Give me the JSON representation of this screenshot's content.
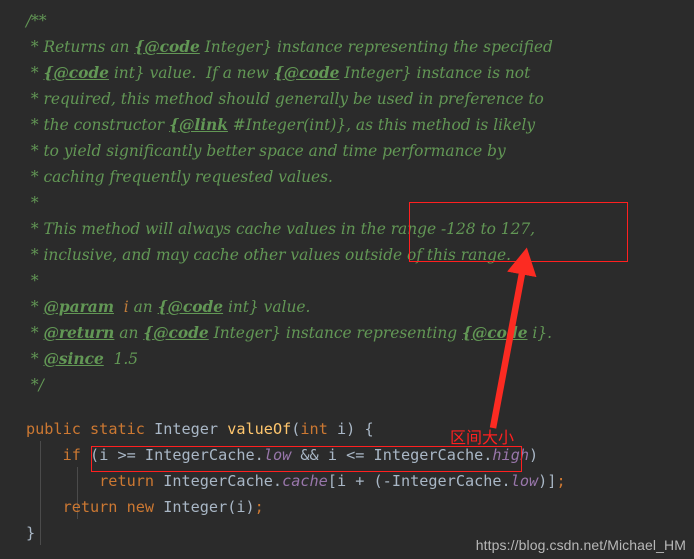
{
  "editor": {
    "background_color": "#2b2b2b",
    "comment_color": "#629755",
    "keyword_color": "#cc7832",
    "identifier_color": "#a9b7c6",
    "method_color": "#ffc66d",
    "field_color": "#9876aa",
    "annotation_color": "#ff2020",
    "watermark_color": "#b8b8b8"
  },
  "javadoc": {
    "line_01": "/**",
    "line_02_pre": " * Returns an ",
    "line_02_tag": "{@code",
    "line_02_post": " Integer} instance representing the specified",
    "line_03_pre": " * ",
    "line_03_tag": "{@code",
    "line_03_mid": " int} value.  If a new ",
    "line_03_tag2": "{@code",
    "line_03_post": " Integer} instance is not",
    "line_04": " * required, this method should generally be used in preference to",
    "line_05_pre": " * the constructor ",
    "line_05_tag": "{@link",
    "line_05_post": " #Integer(int)}, as this method is likely",
    "line_06": " * to yield significantly better space and time performance by",
    "line_07": " * caching frequently requested values.",
    "line_08": " *",
    "line_09": " * This method will always cache values in the range -128 to 127,",
    "line_10": " * inclusive, and may cache other values outside of this range.",
    "line_11": " *",
    "line_12_pre": " * ",
    "line_12_tag": "@param",
    "line_12_space": "  ",
    "line_12_param": "i",
    "line_12_mid": " an ",
    "line_12_tag2": "{@code",
    "line_12_post": " int} value.",
    "line_13_pre": " * ",
    "line_13_tag": "@return",
    "line_13_mid": " an ",
    "line_13_tag2": "{@code",
    "line_13_mid2": " Integer} instance representing ",
    "line_13_tag3": "{@code",
    "line_13_post": " i}.",
    "line_14_pre": " * ",
    "line_14_tag": "@since",
    "line_14_post": "  1.5",
    "line_15": " */"
  },
  "code": {
    "sig_kw1": "public",
    "sig_sp1": " ",
    "sig_kw2": "static",
    "sig_sp2": " ",
    "sig_type": "Integer",
    "sig_sp3": " ",
    "sig_method": "valueOf",
    "sig_paren_open": "(",
    "sig_param_kw": "int",
    "sig_param_sp": " ",
    "sig_param_name": "i",
    "sig_paren_close": ")",
    "sig_brace": " {",
    "if_indent": "    ",
    "if_kw": "if",
    "if_sp": " ",
    "if_open": "(",
    "if_var1": "i",
    "if_op1": " >= ",
    "if_cls1": "IntegerCache.",
    "if_fld1": "low",
    "if_and": " && ",
    "if_var2": "i",
    "if_op2": " <= ",
    "if_cls2": "IntegerCache.",
    "if_fld2": "high",
    "if_close": ")",
    "ret_indent": "        ",
    "ret_kw": "return",
    "ret_sp": " ",
    "ret_cls": "IntegerCache.",
    "ret_fld": "cache",
    "ret_bracket1": "[",
    "ret_var": "i",
    "ret_plus": " + ",
    "ret_paren": "(-",
    "ret_cls2": "IntegerCache.",
    "ret_fld2": "low",
    "ret_paren_close": ")",
    "ret_bracket2": "]",
    "ret_semi": ";",
    "ret2_indent": "    ",
    "ret2_kw1": "return",
    "ret2_sp1": " ",
    "ret2_kw2": "new",
    "ret2_sp2": " ",
    "ret2_type": "Integer",
    "ret2_args": "(i)",
    "ret2_semi": ";",
    "close_brace": "}"
  },
  "annotations": {
    "range_box_label": "range-highlight-box",
    "if_box_label": "if-condition-highlight-box",
    "chinese_note": "区间大小",
    "arrow_label": "red-pointer-arrow"
  },
  "watermark": {
    "url": "https://blog.csdn.net/Michael_HM"
  }
}
